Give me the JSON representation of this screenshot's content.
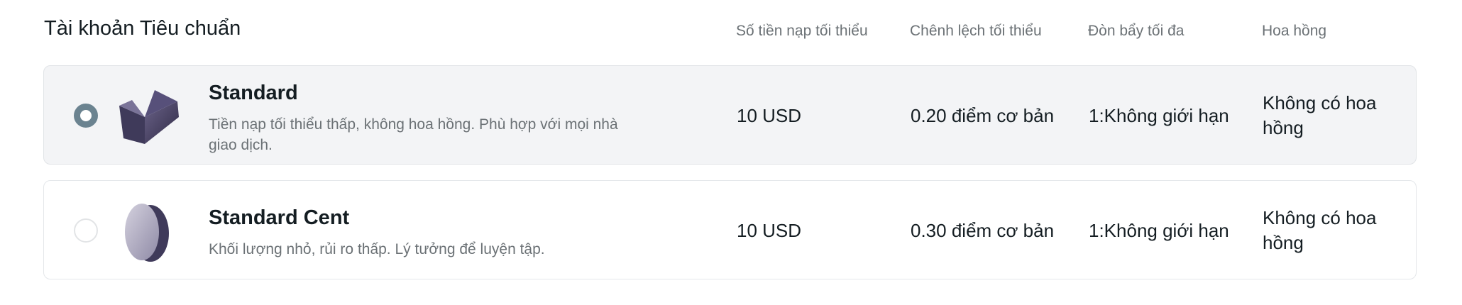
{
  "header": {
    "title": "Tài khoản Tiêu chuẩn",
    "columns": [
      "Số tiền nạp tối thiểu",
      "Chênh lệch tối thiểu",
      "Đòn bẩy tối đa",
      "Hoa hồng"
    ]
  },
  "accounts": [
    {
      "name": "Standard",
      "description": "Tiền nạp tối thiểu thấp, không hoa hồng. Phù hợp với mọi nhà giao dịch.",
      "min_deposit": "10 USD",
      "min_spread": "0.20 điểm cơ bản",
      "max_leverage": "1:Không giới hạn",
      "commission": "Không có hoa hồng",
      "selected": true,
      "icon": "folded-block-icon"
    },
    {
      "name": "Standard Cent",
      "description": "Khối lượng nhỏ, rủi ro thấp. Lý tưởng để luyện tập.",
      "min_deposit": "10 USD",
      "min_spread": "0.30 điểm cơ bản",
      "max_leverage": "1:Không giới hạn",
      "commission": "Không có hoa hồng",
      "selected": false,
      "icon": "coin-disc-icon"
    }
  ],
  "colors": {
    "selected_row_bg": "#f3f4f6",
    "radio_checked": "#6b8390",
    "text_primary": "#141d22",
    "text_secondary": "#6b7175",
    "icon_dark": "#3f3a5a"
  }
}
